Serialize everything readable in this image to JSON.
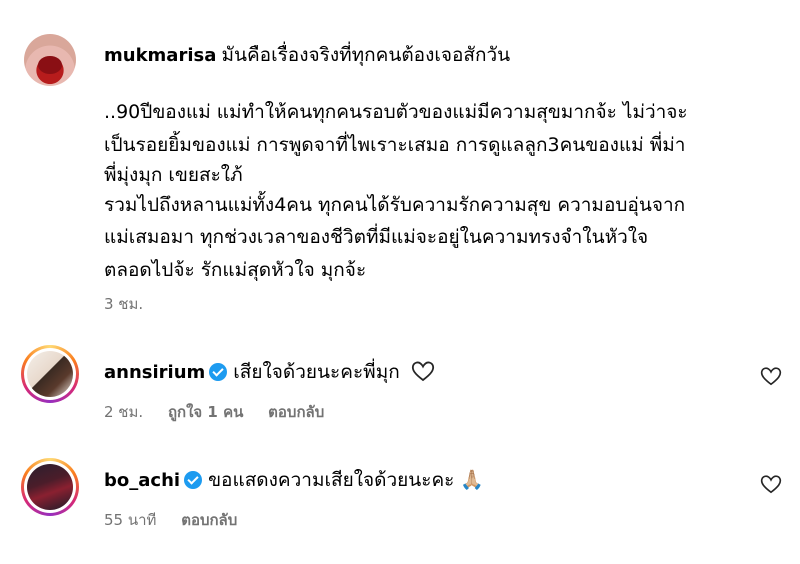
{
  "comments": [
    {
      "username": "mukmarisa",
      "first_line": "มันคือเรื่องจริงที่ทุกคนต้องเจอสักวัน",
      "body_lines": [
        "..90ปีของแม่ แม่ทำให้คนทุกคนรอบตัวของแม่มีความสุขมากจ้ะ ไม่ว่าจะ",
        "เป็นรอยยิ้มของแม่ การพูดจาที่ไพเราะเสมอ การดูแลลูก3คนของแม่ พี่ม่า",
        "พี่มุ่งมุก เขยสะใภ้",
        "รวมไปถึงหลานแม่ทั้ง4คน ทุกคนได้รับความรักความสุข ความอบอุ่นจาก",
        "แม่เสมอมา ทุกช่วงเวลาของชีวิตที่มีแม่จะอยู่ในความทรงจำในหัวใจ",
        "ตลอดไปจ้ะ รักแม่สุดหัวใจ มุกจ้ะ"
      ],
      "time": "3 ชม."
    },
    {
      "username": "annsirium",
      "text": "เสียใจด้วยนะคะพี่มุก",
      "time": "2 ชม.",
      "likes": "ถูกใจ 1 คน",
      "reply": "ตอบกลับ"
    },
    {
      "username": "bo_achi",
      "text": "ขอแสดงความเสียใจด้วยนะคะ",
      "emoji": "🙏🏼",
      "time": "55 นาที",
      "reply": "ตอบกลับ"
    }
  ],
  "icons": {
    "like": "heart-outline-icon",
    "verified": "verified-badge-icon",
    "emoji_hands": "folded-hands-emoji"
  },
  "colors": {
    "verified": "#1d9bf0",
    "meta_text": "#737373"
  }
}
